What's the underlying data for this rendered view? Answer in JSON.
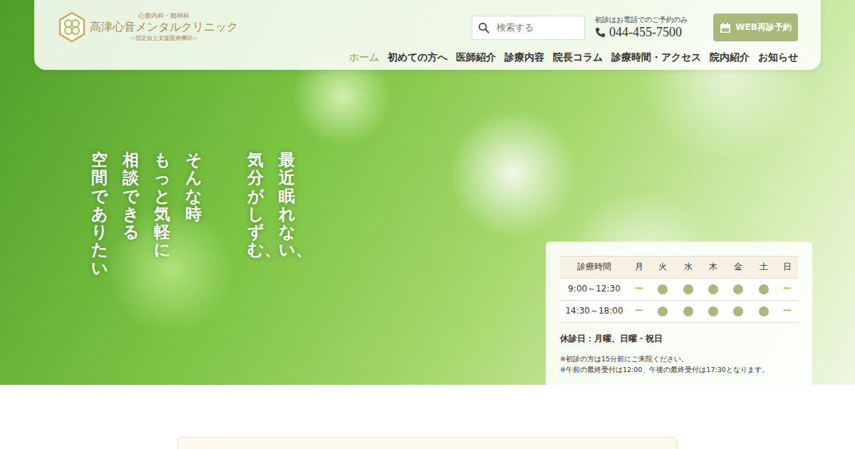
{
  "logo": {
    "tagline": "心療内科・精神科",
    "name": "高津心音メンタルクリニック",
    "subtitle": "＜指定自立支援医療機関＞"
  },
  "search": {
    "placeholder": "検索する"
  },
  "contact": {
    "note": "初診はお電話でのご予約のみ",
    "phone": "044-455-7500"
  },
  "reserve_button": "WEB再診予約",
  "nav": [
    {
      "label": "ホーム",
      "selected": true
    },
    {
      "label": "初めての方へ",
      "selected": false
    },
    {
      "label": "医師紹介",
      "selected": false
    },
    {
      "label": "診療内容",
      "selected": false
    },
    {
      "label": "院長コラム",
      "selected": false
    },
    {
      "label": "診療時間・アクセス",
      "selected": false
    },
    {
      "label": "院内紹介",
      "selected": false
    },
    {
      "label": "お知らせ",
      "selected": false
    }
  ],
  "hero": {
    "groups": [
      [
        "最近眠れない、",
        "気分がしずむ、"
      ],
      [
        "そんな時",
        "もっと気軽に",
        "相談できる",
        "空間でありたい"
      ]
    ]
  },
  "schedule": {
    "header": "診療時間",
    "days": [
      "月",
      "火",
      "水",
      "木",
      "金",
      "土",
      "日"
    ],
    "closed_mark": "ー",
    "rows": [
      {
        "time": "9:00～12:30",
        "open": [
          false,
          true,
          true,
          true,
          true,
          true,
          false
        ]
      },
      {
        "time": "14:30～18:00",
        "open": [
          false,
          true,
          true,
          true,
          true,
          true,
          false
        ]
      }
    ],
    "holidays": "休診日：月曜、日曜・祝日",
    "notes": [
      "※初診の方は15分前にご来院ください。",
      "※午前の最終受付は12:00、午後の最終受付は17:30となります。"
    ]
  }
}
